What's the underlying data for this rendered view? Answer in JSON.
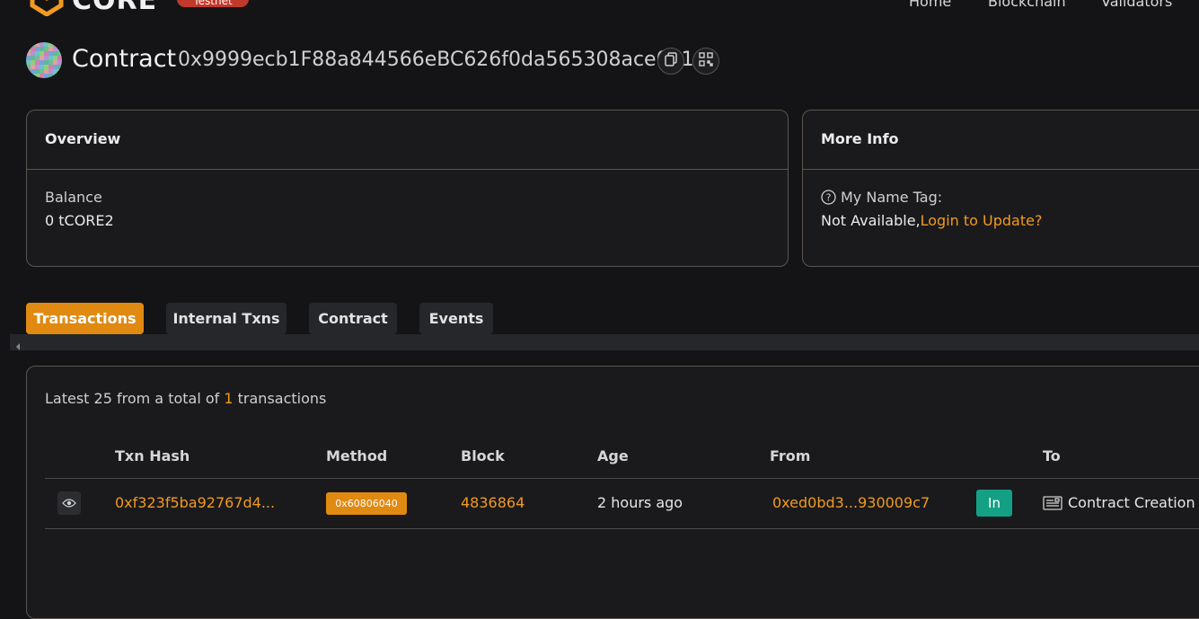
{
  "topbar": {
    "logo_text": "CORE",
    "network_badge": "Testnet",
    "nav": [
      "Home",
      "Blockchain",
      "Validators"
    ]
  },
  "contract": {
    "title": "Contract",
    "address": "0x9999ecb1F88a844566eBC626f0da565308ace061"
  },
  "overview": {
    "title": "Overview",
    "balance_label": "Balance",
    "balance_value": "0 tCORE2"
  },
  "more_info": {
    "title": "More Info",
    "name_tag_label": "My Name Tag:",
    "not_available": "Not Available,",
    "login_link": "Login to Update?"
  },
  "tabs": [
    "Transactions",
    "Internal Txns",
    "Contract",
    "Events"
  ],
  "summary": {
    "prefix": "Latest 25 from a total of ",
    "count": "1",
    "suffix": " transactions"
  },
  "table": {
    "headers": [
      "Txn Hash",
      "Method",
      "Block",
      "Age",
      "From",
      "To"
    ],
    "rows": [
      {
        "hash": "0xf323f5ba92767d4...",
        "method": "0x60806040",
        "block": "4836864",
        "age": "2 hours ago",
        "from": "0xed0bd3...930009c7",
        "direction": "In",
        "to": "Contract Creation"
      }
    ]
  },
  "colors": {
    "accent": "#e08a12",
    "link": "#f29a1f",
    "in_badge": "#14a085",
    "testnet_badge": "#c0392b"
  },
  "icons": [
    "core-logo-icon",
    "copy-icon",
    "qr-code-icon",
    "question-circle-icon",
    "eye-icon",
    "document-icon",
    "scroll-left-arrow-icon"
  ]
}
